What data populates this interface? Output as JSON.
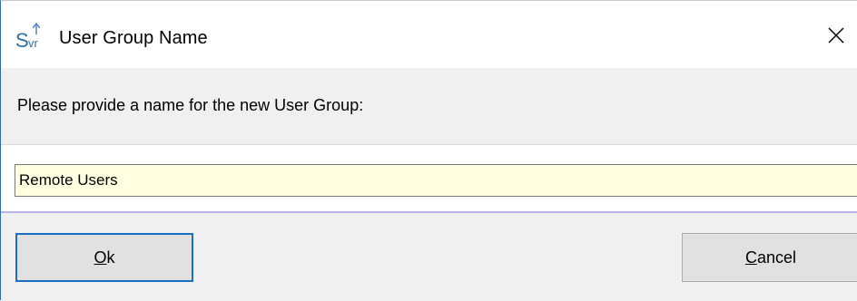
{
  "window": {
    "title": "User Group Name",
    "app_icon": "svr-app-icon",
    "close_glyph": "×"
  },
  "prompt": {
    "text": "Please provide a name for the new User Group:"
  },
  "input": {
    "value": "Remote Users",
    "background": "#ffffe1"
  },
  "buttons": {
    "ok": {
      "mnemonic": "O",
      "rest": "k"
    },
    "cancel": {
      "mnemonic": "C",
      "rest": "ancel"
    }
  },
  "colors": {
    "focus_border": "#1a6fc4",
    "accent_line": "#b8b4e8",
    "dialog_bg": "#f0f0f0"
  }
}
